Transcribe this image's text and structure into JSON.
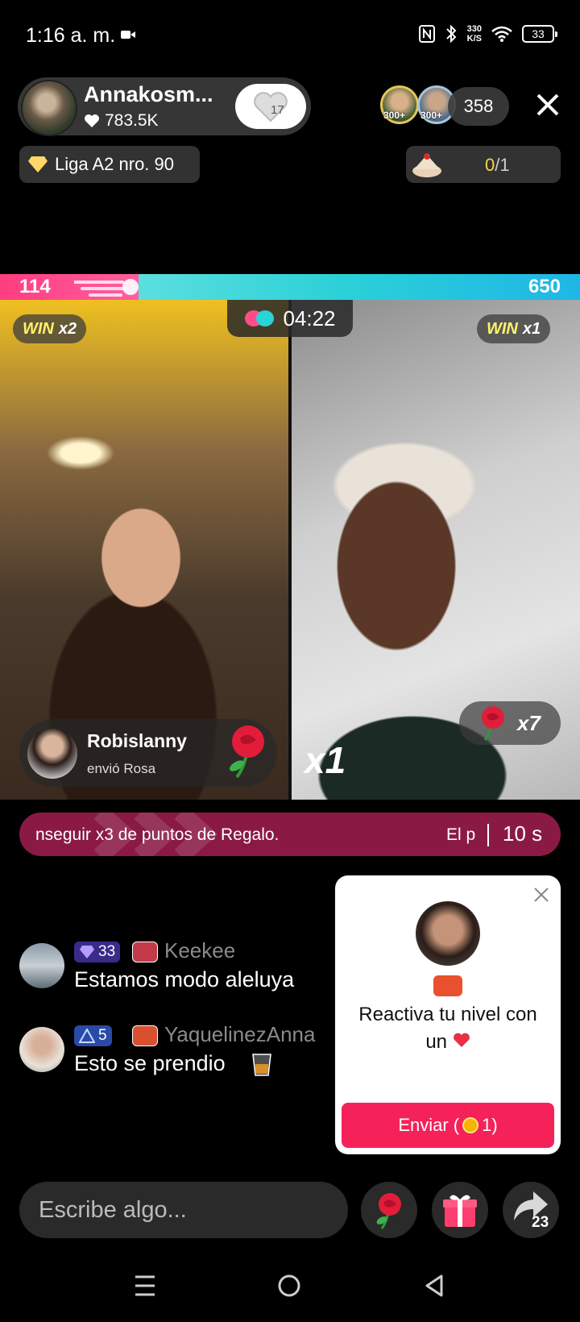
{
  "status_bar": {
    "time": "1:16 a. m.",
    "net_speed_value": "330",
    "net_speed_unit": "K/S",
    "battery": "33"
  },
  "host": {
    "name": "Annakosm...",
    "likes": "783.5K",
    "follow_count": "17",
    "league": "Liga A2 nro. 90",
    "task_done": "0",
    "task_total": "/1"
  },
  "viewers": {
    "badge1": "300+",
    "badge2": "300+",
    "count": "358"
  },
  "battle": {
    "score_left": "114",
    "score_right": "650",
    "timer": "04:22",
    "left_win_word": "WIN",
    "left_win_mult": "x2",
    "right_win_word": "WIN",
    "right_win_mult": "x1",
    "multiplier": "x1"
  },
  "gift_notification": {
    "user": "Robislanny",
    "action": "envió Rosa"
  },
  "rose_counter": "x7",
  "banner": {
    "text": "nseguir x3 de puntos de Regalo.",
    "text2": "El p",
    "timer": "10 s"
  },
  "chat": [
    {
      "level": "33",
      "username": "Keekee",
      "message": "Estamos modo aleluya"
    },
    {
      "level": "5",
      "username": "YaquelinezAnna",
      "message": "Esto se prendio"
    }
  ],
  "popup": {
    "text_line1": "Reactiva tu nivel con",
    "text_line2": "un",
    "button_label": "Enviar (",
    "button_coins": "1)"
  },
  "bottom": {
    "input_placeholder": "Escribe algo...",
    "share_count": "23"
  },
  "colors": {
    "accent": "#f5225a",
    "banner": "#8a1a44",
    "battle_left": "#ff3d7f",
    "battle_right": "#2ad0d8"
  }
}
